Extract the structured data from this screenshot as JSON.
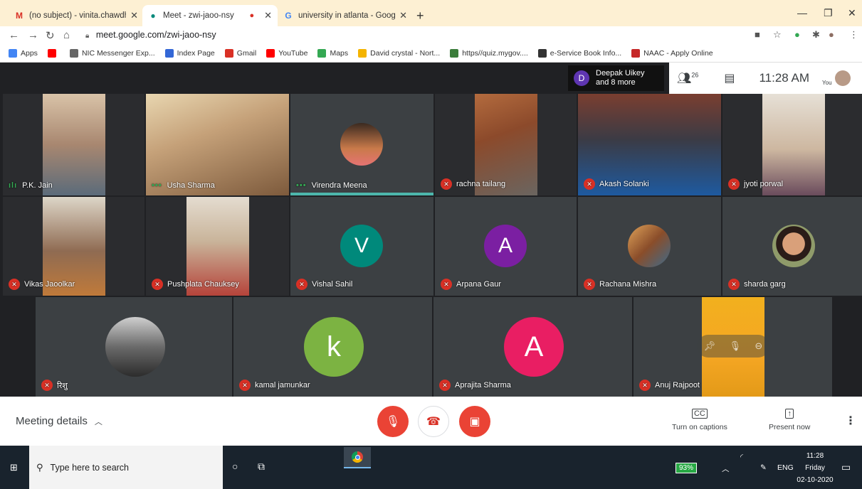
{
  "browser": {
    "tabs": [
      {
        "label": "(no subject) - vinita.chawdhry@g",
        "icon": "gmail-icon",
        "close": "✕"
      },
      {
        "label": "Meet - zwi-jaoo-nsy",
        "icon": "meet-icon",
        "close": "✕"
      },
      {
        "label": "university in atlanta - Google Sea",
        "icon": "google-icon",
        "close": "✕"
      }
    ],
    "new_tab": "+",
    "url": "meet.google.com/zwi-jaoo-nsy",
    "bookmarks": [
      {
        "label": "Apps",
        "color": "#4285f4"
      },
      {
        "label": "",
        "color": "#ff0000"
      },
      {
        "label": "NIC Messenger Exp...",
        "color": "#666666"
      },
      {
        "label": "Index Page",
        "color": "#3367d6"
      },
      {
        "label": "Gmail",
        "color": "#d93025"
      },
      {
        "label": "YouTube",
        "color": "#ff0000"
      },
      {
        "label": "Maps",
        "color": "#34a853"
      },
      {
        "label": "David crystal - Nort...",
        "color": "#f4b400"
      },
      {
        "label": "https//quiz.mygov....",
        "color": "#3b7d3b"
      },
      {
        "label": "e-Service Book Info...",
        "color": "#333333"
      },
      {
        "label": "NAAC - Apply Online",
        "color": "#c62828"
      }
    ]
  },
  "meet": {
    "join_info": {
      "avatar_letter": "D",
      "line1": "Deepak Uikey",
      "line2": "and 8 more"
    },
    "people_count": "26",
    "time": "11:28 AM",
    "you_label": "You",
    "participants": [
      {
        "name": "P.K. Jain",
        "status": "speaking"
      },
      {
        "name": "Usha Sharma",
        "status": "dots"
      },
      {
        "name": "Virendra Meena",
        "status": "dots"
      },
      {
        "name": "rachna tailang",
        "status": "muted"
      },
      {
        "name": "Akash Solanki",
        "status": "muted"
      },
      {
        "name": "jyoti porwal",
        "status": "muted"
      },
      {
        "name": "Vikas Jaoolkar",
        "status": "muted"
      },
      {
        "name": "Pushplata Chauksey",
        "status": "muted"
      },
      {
        "name": "Vishal Sahil",
        "status": "muted",
        "letter": "V",
        "color": "#00897b"
      },
      {
        "name": "Arpana Gaur",
        "status": "muted",
        "letter": "A",
        "color": "#7b1fa2"
      },
      {
        "name": "Rachana Mishra",
        "status": "muted"
      },
      {
        "name": "sharda garg",
        "status": "muted"
      },
      {
        "name": "रिशु",
        "status": "muted"
      },
      {
        "name": "kamal jamunkar",
        "status": "muted",
        "letter": "k",
        "color": "#7cb342"
      },
      {
        "name": "Aprajita Sharma",
        "status": "muted",
        "letter": "A",
        "color": "#e91e63"
      },
      {
        "name": "Anuj Rajpoot",
        "status": "muted"
      }
    ]
  },
  "controls": {
    "meeting_details": "Meeting details",
    "captions": "Turn on captions",
    "captions_icon": "CC",
    "present": "Present now"
  },
  "taskbar": {
    "search_placeholder": "Type here to search",
    "battery": "93%",
    "lang": "ENG",
    "time": "11:28",
    "day": "Friday",
    "date": "02-10-2020"
  }
}
